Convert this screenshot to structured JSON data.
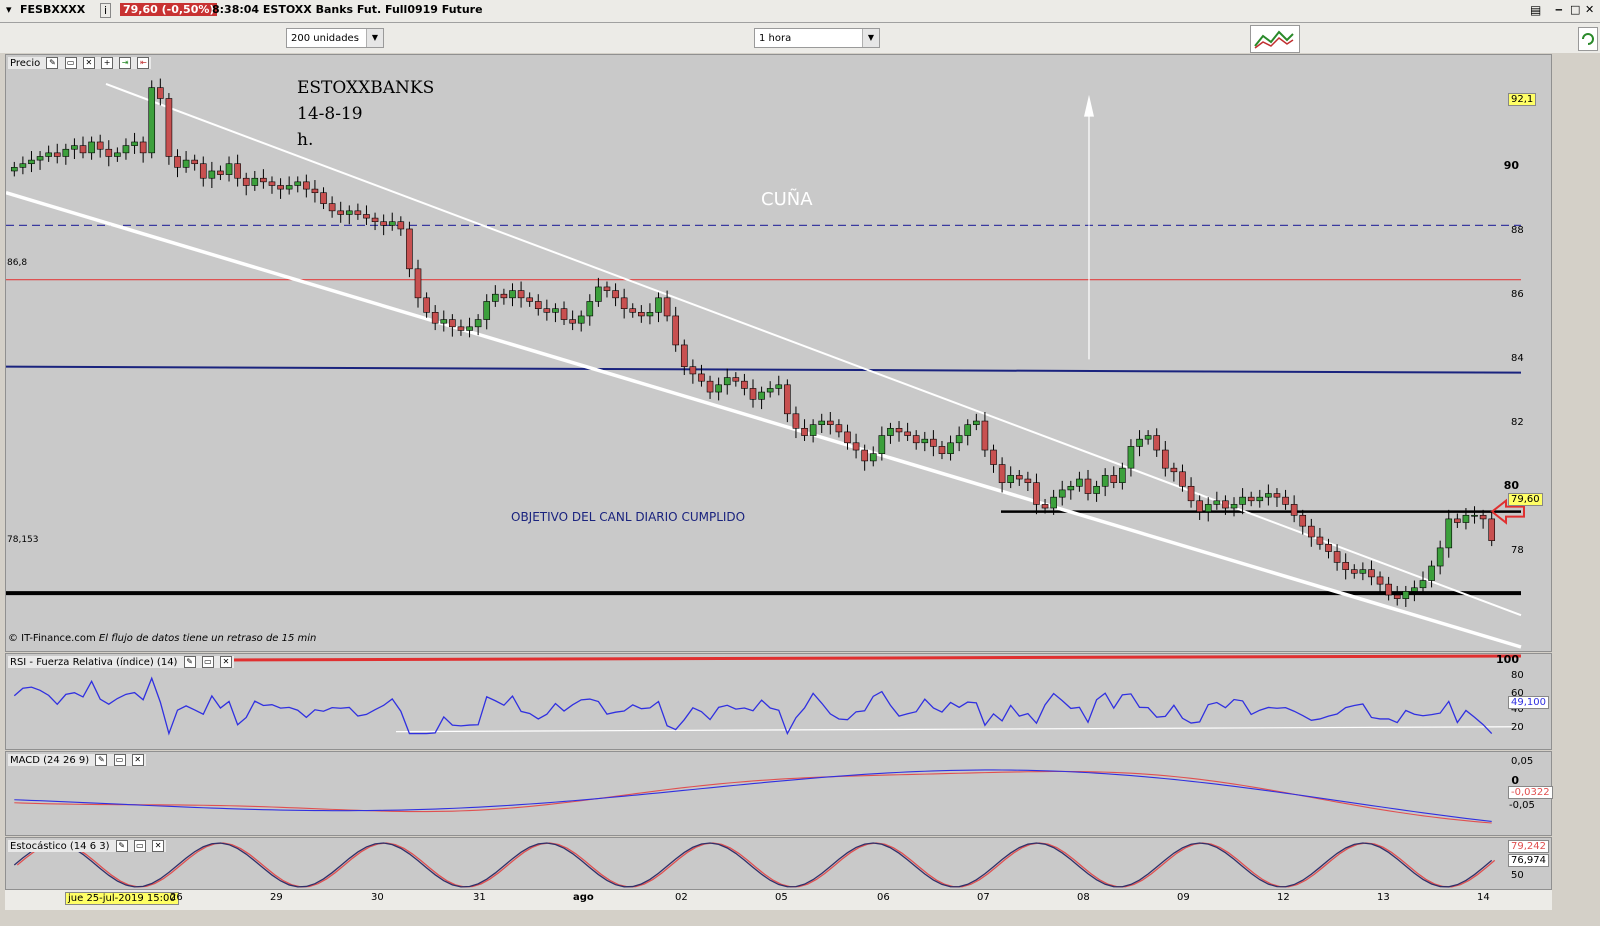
{
  "titlebar": {
    "symbol": "FESBXXXX",
    "info_icon": "i",
    "price_change": "79,60 (-0,50%)",
    "description": "8:38:04 ESTOXX Banks Fut. Full0919 Future"
  },
  "toolbar": {
    "units_select": "200 unidades",
    "period_select": "1 hora"
  },
  "price_panel": {
    "label": "Precio",
    "annotation_lines": [
      "ESTOXXBANKS",
      "14-8-19",
      "h."
    ],
    "cuna_text": "CUÑA",
    "objective_text": "OBJETIVO DEL CANL DIARIO CUMPLIDO",
    "level_868_label": "86,8",
    "level_78153_label": "78,153",
    "last_price_tag": "79,60",
    "high_tag": "92,1",
    "footer": "© IT-Finance.com",
    "footer_italic": "El flujo de datos tiene un retraso de 15 min",
    "y_ticks": [
      "90",
      "88",
      "86",
      "84",
      "82",
      "80",
      "78"
    ]
  },
  "rsi_panel": {
    "label": "RSI - Fuerza Relativa (índice) (14)",
    "y_ticks": [
      "100",
      "80",
      "60",
      "40",
      "20"
    ],
    "value_tag": "49,100"
  },
  "macd_panel": {
    "label": "MACD (24 26 9)",
    "y_ticks": [
      "0,05",
      "0",
      "-0,05"
    ],
    "value_tag": "-0,0322"
  },
  "stoch_panel": {
    "label": "Estocástico (14 6 3)",
    "y_ticks": [
      "50"
    ],
    "value_tag_1": "79,242",
    "value_tag_2": "76,974"
  },
  "x_axis": {
    "cursor_label": "jue 25-jul-2019 15:00",
    "ticks": [
      "26",
      "29",
      "30",
      "31",
      "ago",
      "02",
      "05",
      "06",
      "07",
      "08",
      "09",
      "12",
      "13",
      "14"
    ]
  },
  "colors": {
    "bull": "#3ca03c",
    "bear": "#c85050",
    "wedge": "#ffffff",
    "blue_line": "#1a237e",
    "red_level": "#e04040",
    "rsi": "#3030e0",
    "macd_signal": "#e05050"
  },
  "chart_data": {
    "type": "candlestick",
    "title": "ESTOXXBANKS",
    "ylim": [
      76.5,
      93
    ],
    "horizontal_levels": [
      {
        "value": 88.3,
        "style": "dashed",
        "color": "#3a3aa0"
      },
      {
        "value": 86.8,
        "style": "solid",
        "color": "#e04040"
      },
      {
        "value": 84.4,
        "style": "solid",
        "color": "#1a237e"
      },
      {
        "value": 80.4,
        "style": "solid",
        "color": "#000000"
      },
      {
        "value": 78.153,
        "style": "solid",
        "color": "#000000"
      }
    ],
    "closes": [
      89.9,
      90.0,
      90.1,
      90.2,
      90.3,
      90.2,
      90.4,
      90.5,
      90.3,
      90.6,
      90.4,
      90.2,
      90.3,
      90.5,
      90.6,
      90.3,
      92.1,
      91.8,
      90.2,
      89.9,
      90.1,
      90.0,
      89.6,
      89.8,
      89.7,
      90.0,
      89.6,
      89.4,
      89.6,
      89.5,
      89.4,
      89.3,
      89.4,
      89.5,
      89.3,
      89.2,
      88.9,
      88.7,
      88.6,
      88.7,
      88.6,
      88.5,
      88.4,
      88.3,
      88.4,
      88.2,
      87.1,
      86.3,
      85.9,
      85.6,
      85.7,
      85.5,
      85.4,
      85.5,
      85.7,
      86.2,
      86.4,
      86.3,
      86.5,
      86.3,
      86.2,
      86.0,
      85.9,
      86.0,
      85.7,
      85.6,
      85.8,
      86.2,
      86.6,
      86.5,
      86.3,
      86.0,
      85.9,
      85.8,
      85.9,
      86.3,
      85.8,
      85.0,
      84.4,
      84.2,
      84.0,
      83.7,
      83.9,
      84.1,
      84.0,
      83.8,
      83.5,
      83.7,
      83.8,
      83.9,
      83.1,
      82.7,
      82.5,
      82.8,
      82.9,
      82.8,
      82.6,
      82.3,
      82.1,
      81.8,
      82.0,
      82.5,
      82.7,
      82.6,
      82.5,
      82.3,
      82.4,
      82.2,
      82.0,
      82.3,
      82.5,
      82.8,
      82.9,
      82.1,
      81.7,
      81.2,
      81.4,
      81.3,
      81.2,
      80.6,
      80.5,
      80.8,
      81.0,
      81.1,
      81.3,
      80.9,
      81.1,
      81.4,
      81.2,
      81.6,
      82.2,
      82.4,
      82.5,
      82.1,
      81.6,
      81.5,
      81.1,
      80.7,
      80.4,
      80.6,
      80.7,
      80.5,
      80.6,
      80.8,
      80.7,
      80.8,
      80.9,
      80.8,
      80.6,
      80.3,
      80.0,
      79.7,
      79.5,
      79.3,
      79.0,
      78.8,
      78.7,
      78.8,
      78.6,
      78.4,
      78.1,
      78.0,
      78.2,
      78.3,
      78.5,
      78.9,
      79.4,
      80.2,
      80.1,
      80.3,
      80.3,
      80.2,
      79.6
    ]
  }
}
